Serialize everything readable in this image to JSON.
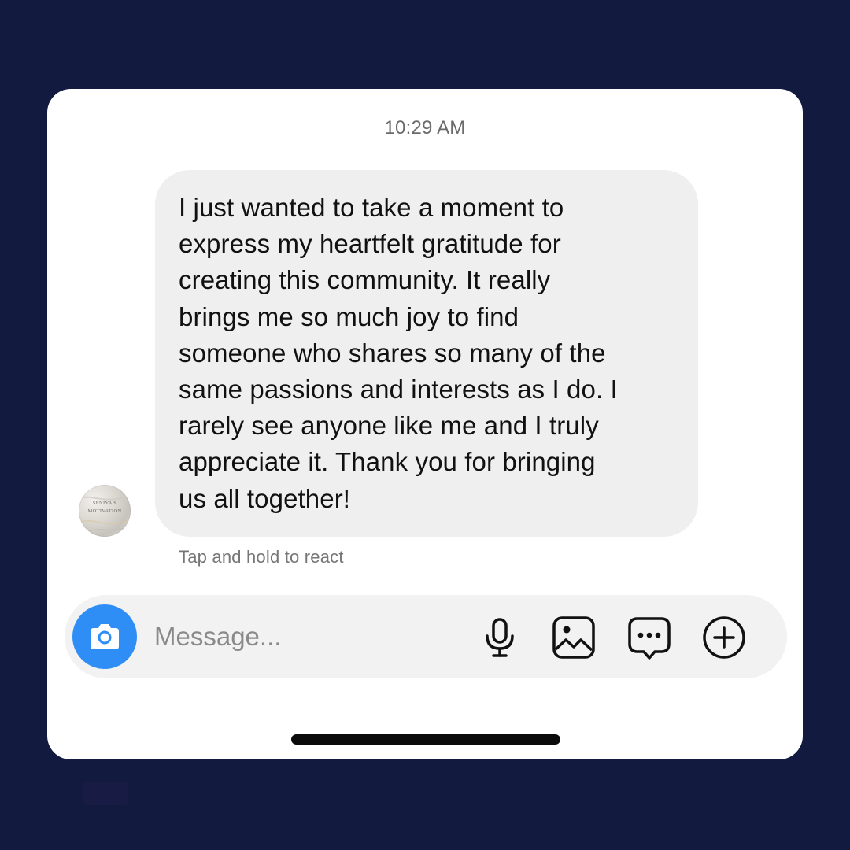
{
  "conversation": {
    "timestamp": "10:29 AM",
    "message": {
      "text": "I just wanted to take a moment to\nexpress my heartfelt gratitude for\ncreating this community. It really\nbrings me so much joy to find\nsomeone who shares so many of the\nsame passions and interests as I do. I\nrarely see anyone like me and I truly\nappreciate it. Thank you for bringing\nus all together!"
    },
    "sender_avatar": {
      "icon": "logo-avatar",
      "logo_text_line1": "SENIYA'S",
      "logo_text_line2": "MOTIVATION"
    },
    "reaction_hint": "Tap and hold to react"
  },
  "composer": {
    "placeholder": "Message...",
    "value": "",
    "buttons": [
      {
        "name": "camera-button",
        "icon": "camera-icon"
      },
      {
        "name": "voice-button",
        "icon": "microphone-icon"
      },
      {
        "name": "gallery-button",
        "icon": "image-icon"
      },
      {
        "name": "sticker-button",
        "icon": "chat-bubble-dots-icon"
      },
      {
        "name": "more-button",
        "icon": "plus-circle-icon"
      }
    ]
  },
  "colors": {
    "background": "#121a40",
    "card": "#ffffff",
    "bubble": "#efefef",
    "accent": "#2f8ef5",
    "composer": "#f2f2f2"
  }
}
